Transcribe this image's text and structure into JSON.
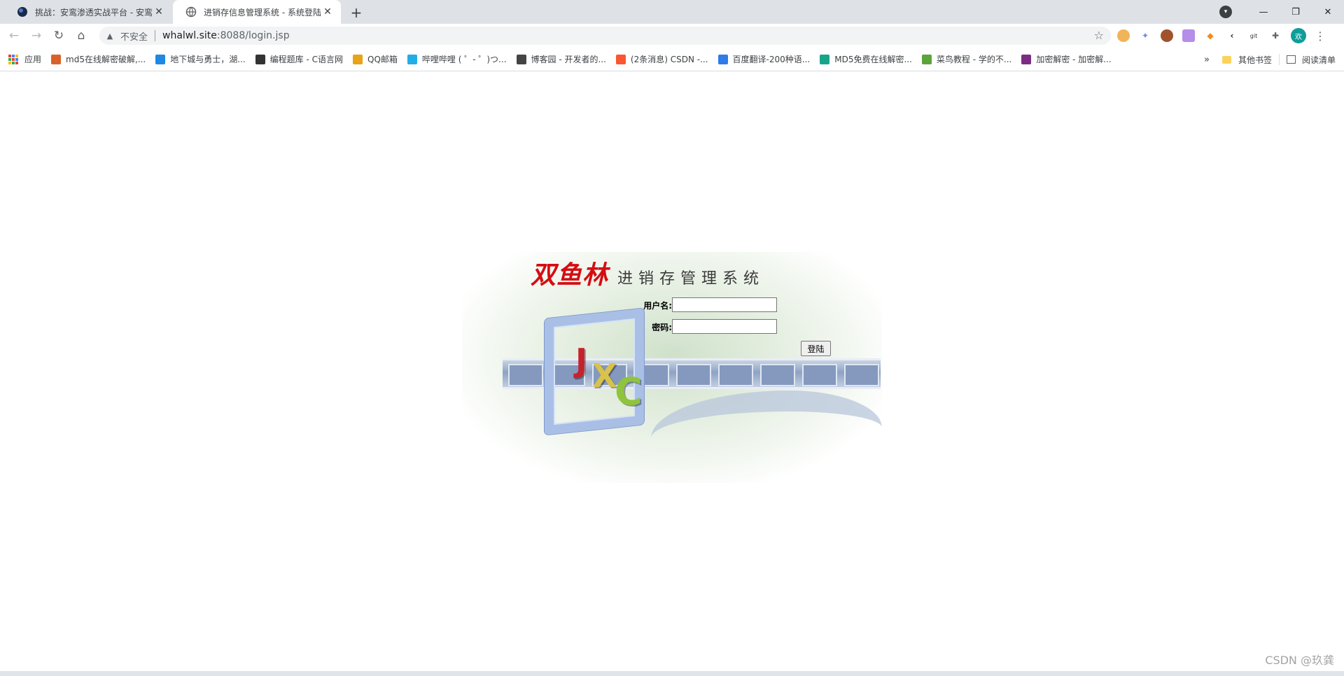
{
  "tabs": [
    {
      "title": "挑战：安鸾渗透实战平台 - 安鸾学",
      "active": false
    },
    {
      "title": "进销存信息管理系统 - 系统登陆",
      "active": true
    }
  ],
  "omnibox": {
    "security_label": "不安全",
    "host": "whalwl.site",
    "path": ":8088/login.jsp"
  },
  "bookmarks": {
    "apps_label": "应用",
    "items": [
      {
        "label": "md5在线解密破解,...",
        "icon": "md5-site-icon",
        "color": "#d9622b"
      },
      {
        "label": "地下城与勇士，湖...",
        "icon": "u-site-icon",
        "color": "#1e88e5"
      },
      {
        "label": "编程题库 - C语言网",
        "icon": "c-site-icon",
        "color": "#333333"
      },
      {
        "label": "QQ邮箱",
        "icon": "qq-mail-icon",
        "color": "#e8a317"
      },
      {
        "label": "哔哩哔哩 ( ゜- ゜)つ...",
        "icon": "bilibili-icon",
        "color": "#23ade5"
      },
      {
        "label": "博客园 - 开发者的...",
        "icon": "cnblogs-icon",
        "color": "#444444"
      },
      {
        "label": "(2条消息) CSDN -...",
        "icon": "csdn-icon",
        "color": "#fc5531"
      },
      {
        "label": "百度翻译-200种语...",
        "icon": "baidu-translate-icon",
        "color": "#2f7be8"
      },
      {
        "label": "MD5免费在线解密...",
        "icon": "md5-free-icon",
        "color": "#17a589"
      },
      {
        "label": "菜鸟教程 - 学的不...",
        "icon": "runoob-icon",
        "color": "#5aa43a"
      },
      {
        "label": "加密解密 - 加密解...",
        "icon": "encrypt-icon",
        "color": "#7b2d83"
      }
    ],
    "other_label": "其他书签",
    "reading_label": "阅读清单"
  },
  "profile": {
    "initial": "欢"
  },
  "login": {
    "brand": "双鱼林",
    "subtitle": "进销存管理系统",
    "username_label": "用户名:",
    "password_label": "密码:",
    "submit_label": "登陆",
    "username_value": "",
    "password_value": "",
    "logo_letters": [
      "J",
      "X",
      "C"
    ]
  },
  "watermark": "CSDN @玖龚"
}
